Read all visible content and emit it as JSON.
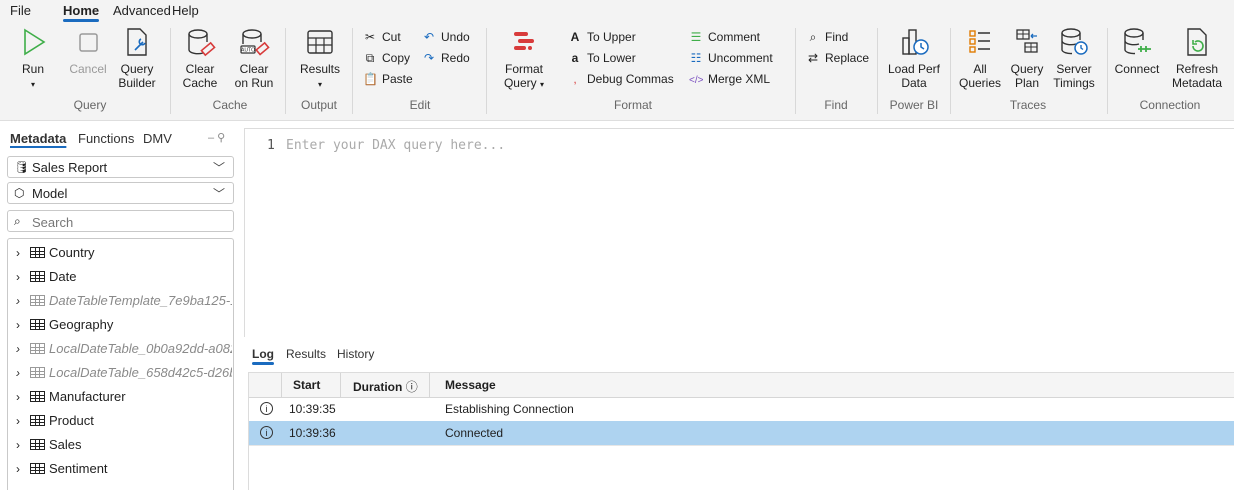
{
  "menu": [
    "File",
    "Home",
    "Advanced",
    "Help"
  ],
  "ribbon": {
    "query": {
      "run": "Run",
      "cancel": "Cancel",
      "builder_1": "Query",
      "builder_2": "Builder",
      "group": "Query"
    },
    "cache": {
      "clear_1": "Clear",
      "clear_2": "Cache",
      "clear_run_1": "Clear",
      "clear_run_2": "on Run",
      "group": "Cache"
    },
    "output": {
      "results": "Results",
      "group": "Output"
    },
    "edit": {
      "cut": "Cut",
      "copy": "Copy",
      "paste": "Paste",
      "undo": "Undo",
      "redo": "Redo",
      "group": "Edit"
    },
    "format": {
      "format_1": "Format",
      "format_2": "Query",
      "to_upper": "To Upper",
      "to_lower": "To Lower",
      "debug_commas": "Debug Commas",
      "comment": "Comment",
      "uncomment": "Uncomment",
      "merge_xml": "Merge XML",
      "group": "Format"
    },
    "find": {
      "find": "Find",
      "replace": "Replace",
      "group": "Find"
    },
    "powerbi": {
      "load_1": "Load Perf",
      "load_2": "Data",
      "group": "Power BI"
    },
    "traces": {
      "all_1": "All",
      "all_2": "Queries",
      "plan_1": "Query",
      "plan_2": "Plan",
      "timings_1": "Server",
      "timings_2": "Timings",
      "group": "Traces"
    },
    "connection": {
      "connect": "Connect",
      "refresh_1": "Refresh",
      "refresh_2": "Metadata",
      "group": "Connection"
    }
  },
  "side_tabs": [
    "Metadata",
    "Functions",
    "DMV"
  ],
  "database": "Sales Report",
  "model": "Model",
  "search_placeholder": "Search",
  "tables": [
    {
      "name": "Country",
      "hidden": false
    },
    {
      "name": "Date",
      "hidden": false
    },
    {
      "name": "DateTableTemplate_7e9ba125-1...",
      "hidden": true
    },
    {
      "name": "Geography",
      "hidden": false
    },
    {
      "name": "LocalDateTable_0b0a92dd-a082...",
      "hidden": true
    },
    {
      "name": "LocalDateTable_658d42c5-d26b-...",
      "hidden": true
    },
    {
      "name": "Manufacturer",
      "hidden": false
    },
    {
      "name": "Product",
      "hidden": false
    },
    {
      "name": "Sales",
      "hidden": false
    },
    {
      "name": "Sentiment",
      "hidden": false
    }
  ],
  "editor": {
    "line": "1",
    "placeholder": "Enter your DAX query here..."
  },
  "output_tabs": [
    "Log",
    "Results",
    "History"
  ],
  "log": {
    "columns": [
      "Start",
      "Duration",
      "Message"
    ],
    "rows": [
      {
        "start": "10:39:35",
        "duration": "",
        "message": "Establishing Connection",
        "selected": false
      },
      {
        "start": "10:39:36",
        "duration": "",
        "message": "Connected",
        "selected": true
      }
    ]
  },
  "colors": {
    "accent": "#1a6bbf",
    "run_green": "#3fae49",
    "selected_row": "#aed3f0",
    "clear_red": "#d83b3b"
  }
}
